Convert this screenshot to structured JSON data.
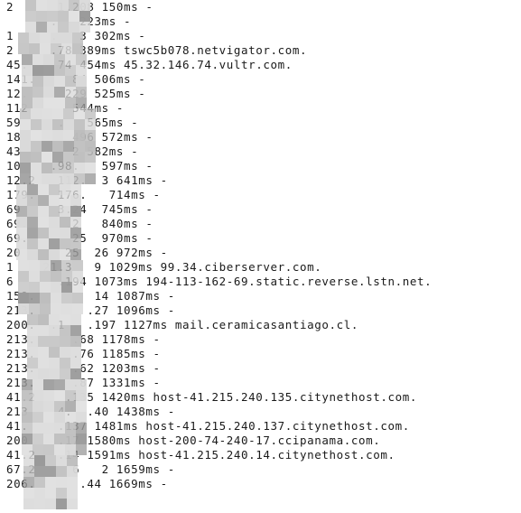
{
  "lines": [
    "2      1.208 150ms -",
    "      .   223ms -",
    "1     .   3 302ms -",
    "2     .78 389ms tswc5b078.netvigator.com.",
    "45.    74 454ms 45.32.146.74.vultr.com.",
    "141.     84 506ms -",
    "12.     229 525ms -",
    "112      544ms -",
    "59     .   565ms -",
    "18       496 572ms -",
    "43       2 582ms -",
    "10    .98.   597ms -",
    "12.2   112.  3 641ms -",
    "179.   176.   714ms -",
    "69     3.24  745ms -",
    "69.     .2   840ms -",
    "69.      25  970ms -",
    "20      25  26 972ms -",
    "1    21.3   9 1029ms 99.34.ciberserver.com.",
    "6      .194 1073ms 194-113-162-69.static.reverse.lstn.net.",
    "159.        14 1087ms -",
    "213.       .27 1096ms -",
    "200.  .1   .197 1127ms mail.ceramicasantiago.cl.",
    "213.     .68 1178ms -",
    "213.     .76 1185ms -",
    "213.     .62 1203ms -",
    "213.     .87 1331ms -",
    "41.2    .135 1420ms host-41.215.240.135.citynethost.com.",
    "213    4.  .40 1438ms -",
    "41.    .137 1481ms host-41.215.240.137.citynethost.com.",
    "200    .17 1580ms host-200-74-240-17.ccipanama.com.",
    "41.2   .14 1591ms host-41.215.240.14.citynethost.com.",
    "67.2     6   2 1659ms -",
    "206.      .44 1669ms -"
  ],
  "colors": {
    "background": "#ffffff",
    "text": "#1a1a1a",
    "mask_light": "#d9d9d9",
    "mask_mid": "#bdbdbd",
    "mask_dark": "#9a9a9a"
  }
}
